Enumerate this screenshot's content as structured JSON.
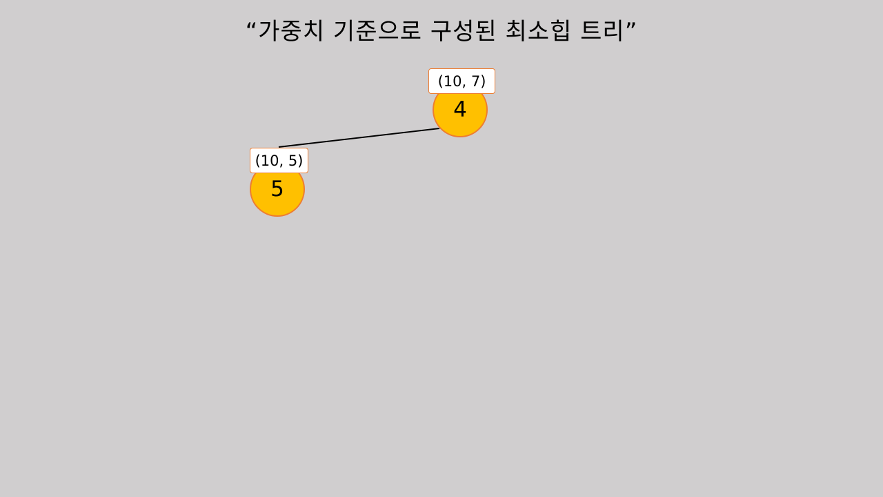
{
  "title": "“가중치 기준으로 구성된 최소힙 트리”",
  "colors": {
    "background": "#d0cecf",
    "node_fill": "#ffc000",
    "node_border": "#ed7d31",
    "label_fill": "#ffffff",
    "edge": "#000000"
  },
  "tree": {
    "root": {
      "value": "4",
      "label": "(10, 7)"
    },
    "child": {
      "value": "5",
      "label": "(10, 5)"
    }
  }
}
